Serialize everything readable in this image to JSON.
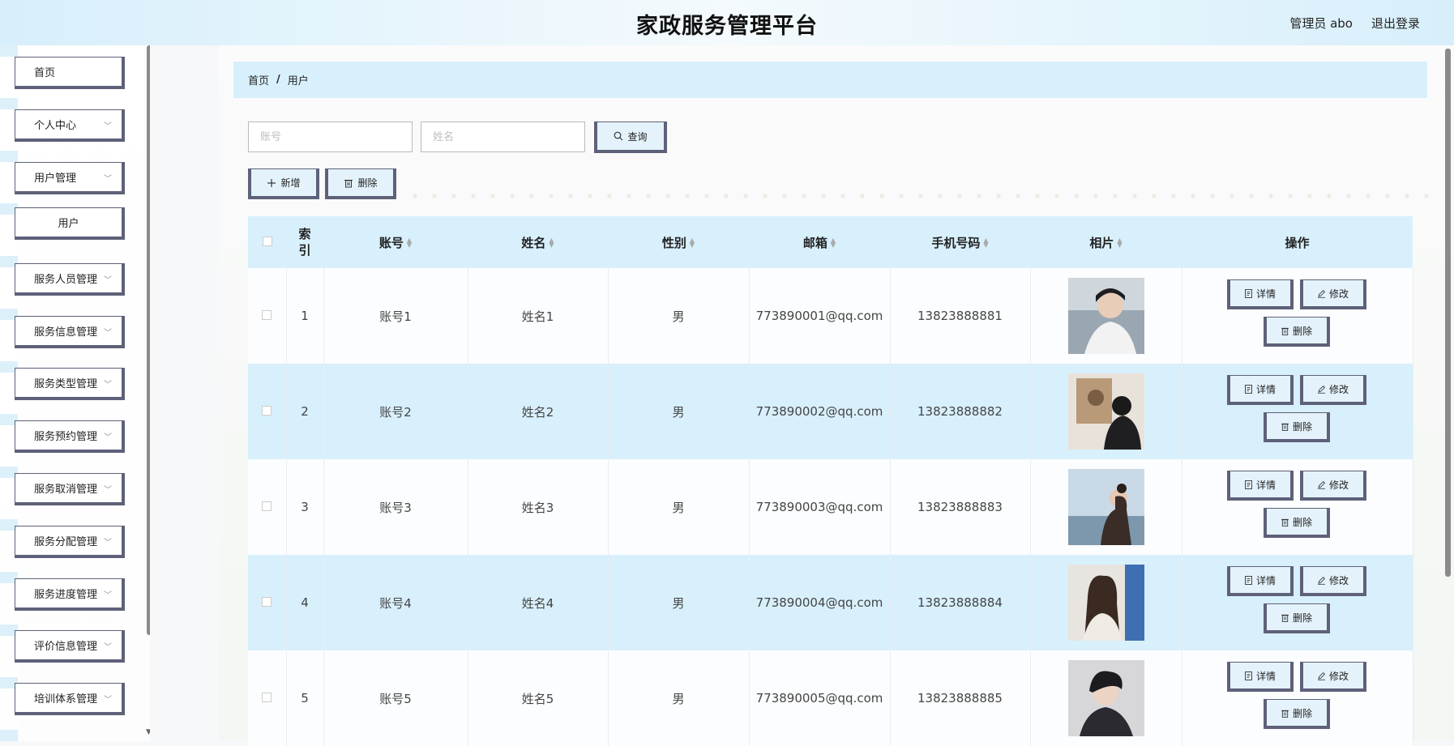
{
  "header": {
    "title": "家政服务管理平台",
    "user": "管理员 abo",
    "logout": "退出登录"
  },
  "sidebar": {
    "items": [
      {
        "label": "首页",
        "has_children": false
      },
      {
        "label": "个人中心",
        "has_children": true
      },
      {
        "label": "用户管理",
        "has_children": true
      },
      {
        "label": "用户",
        "has_children": false,
        "sub": true
      },
      {
        "label": "服务人员管理",
        "has_children": true
      },
      {
        "label": "服务信息管理",
        "has_children": true
      },
      {
        "label": "服务类型管理",
        "has_children": true
      },
      {
        "label": "服务预约管理",
        "has_children": true
      },
      {
        "label": "服务取消管理",
        "has_children": true
      },
      {
        "label": "服务分配管理",
        "has_children": true
      },
      {
        "label": "服务进度管理",
        "has_children": true
      },
      {
        "label": "评价信息管理",
        "has_children": true
      },
      {
        "label": "培训体系管理",
        "has_children": true
      }
    ]
  },
  "breadcrumb": {
    "home": "首页",
    "separator": "/",
    "current": "用户"
  },
  "search": {
    "account_placeholder": "账号",
    "name_placeholder": "姓名",
    "query_label": "查询"
  },
  "toolbar": {
    "add_label": "新增",
    "delete_label": "删除"
  },
  "table": {
    "columns": [
      "索引",
      "账号",
      "姓名",
      "性别",
      "邮箱",
      "手机号码",
      "相片",
      "操作"
    ],
    "rows": [
      {
        "index": "1",
        "account": "账号1",
        "name": "姓名1",
        "gender": "男",
        "email": "773890001@qq.com",
        "phone": "13823888881"
      },
      {
        "index": "2",
        "account": "账号2",
        "name": "姓名2",
        "gender": "男",
        "email": "773890002@qq.com",
        "phone": "13823888882"
      },
      {
        "index": "3",
        "account": "账号3",
        "name": "姓名3",
        "gender": "男",
        "email": "773890003@qq.com",
        "phone": "13823888883"
      },
      {
        "index": "4",
        "account": "账号4",
        "name": "姓名4",
        "gender": "男",
        "email": "773890004@qq.com",
        "phone": "13823888884"
      },
      {
        "index": "5",
        "account": "账号5",
        "name": "姓名5",
        "gender": "男",
        "email": "773890005@qq.com",
        "phone": "13823888885"
      }
    ],
    "row_actions": {
      "detail": "详情",
      "edit": "修改",
      "delete": "删除"
    }
  },
  "colors": {
    "accent": "#d8f0fc",
    "button_border": "#5e6179"
  },
  "icons": {
    "query": "search-icon",
    "add": "plus-icon",
    "delete": "trash-icon",
    "detail": "document-icon",
    "edit": "pencil-icon",
    "expand": "chevron-down-icon"
  }
}
